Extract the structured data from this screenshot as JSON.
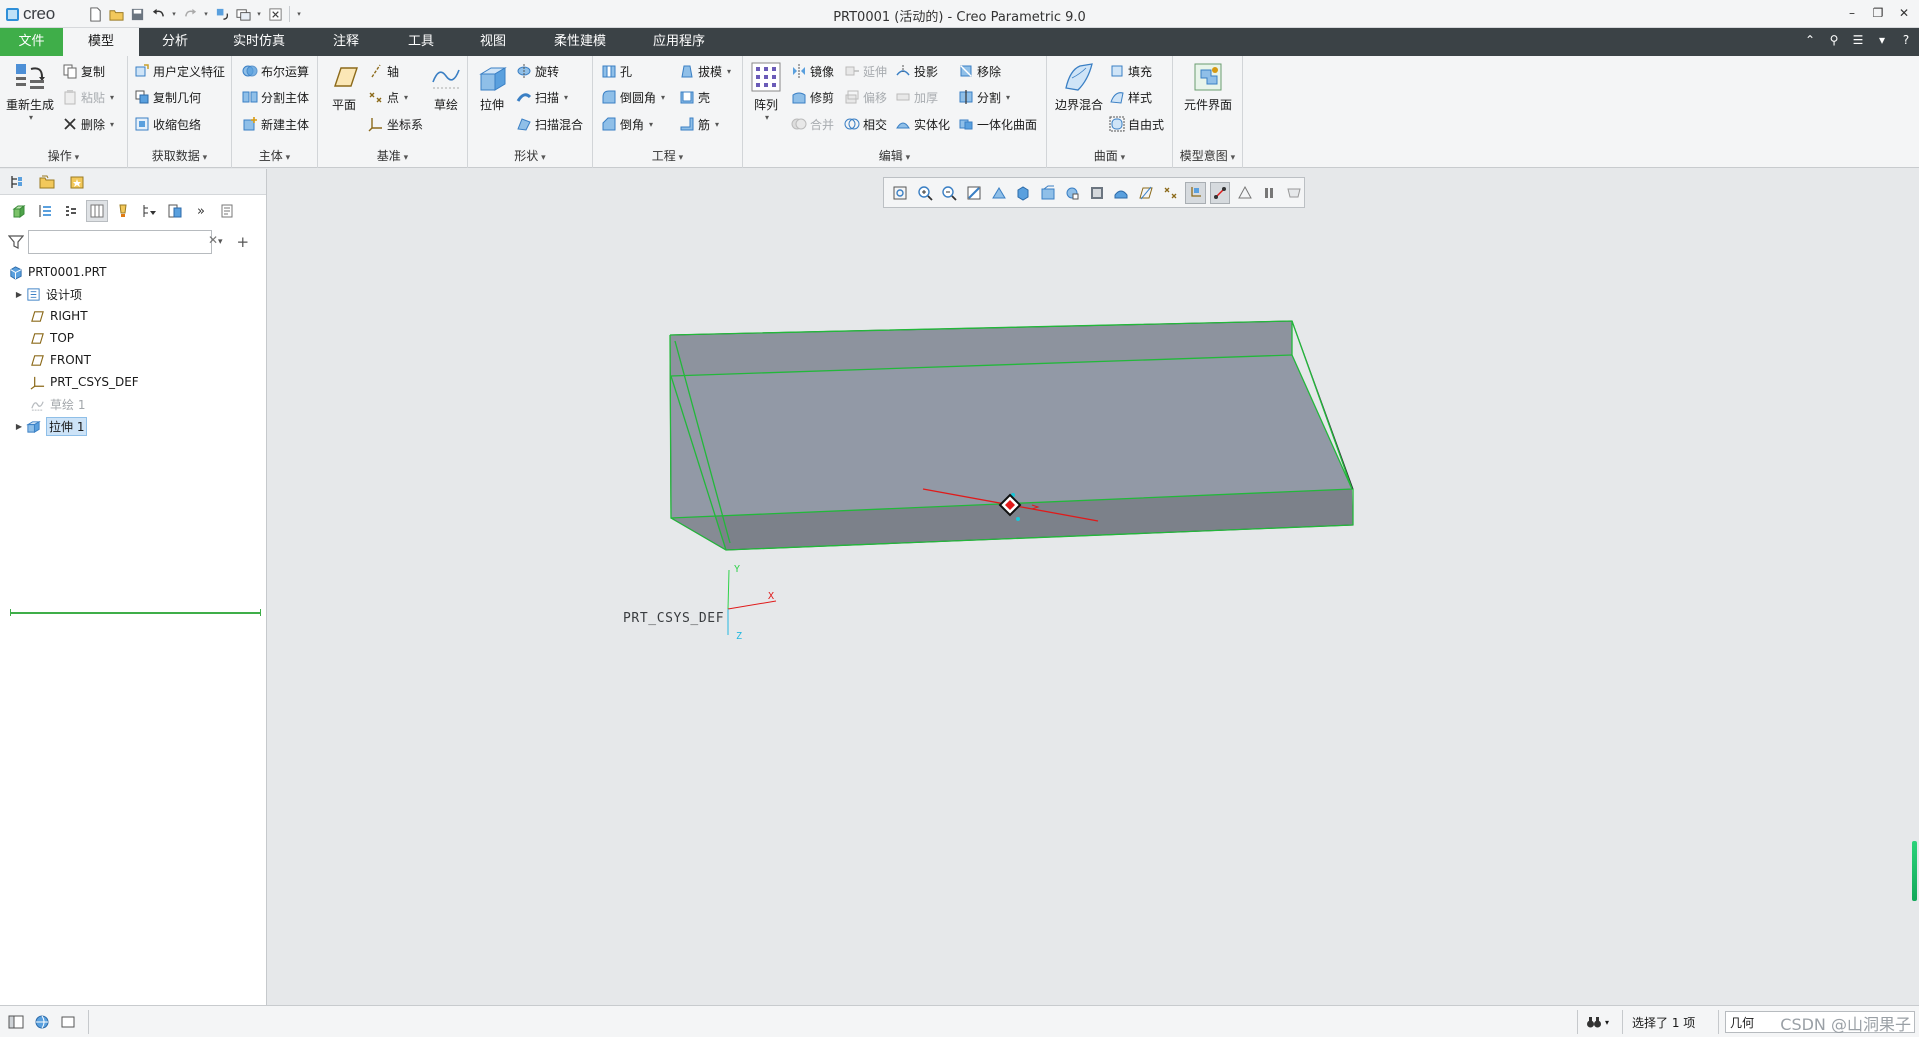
{
  "app": {
    "logo_text": "creo",
    "window_title": "PRT0001 (活动的) - Creo Parametric 9.0",
    "window_controls": [
      "–",
      "❐",
      "✕"
    ]
  },
  "tabs": [
    {
      "label": "文件",
      "kind": "file"
    },
    {
      "label": "模型",
      "kind": "active"
    },
    {
      "label": "分析",
      "kind": "normal"
    },
    {
      "label": "实时仿真",
      "kind": "normal"
    },
    {
      "label": "注释",
      "kind": "normal"
    },
    {
      "label": "工具",
      "kind": "normal"
    },
    {
      "label": "视图",
      "kind": "normal"
    },
    {
      "label": "柔性建模",
      "kind": "normal"
    },
    {
      "label": "应用程序",
      "kind": "normal"
    }
  ],
  "ribbon": {
    "operations": {
      "name": "操作",
      "regenerate": "重新生成",
      "copy": "复制",
      "paste": "粘贴",
      "delete": "删除"
    },
    "get_data": {
      "name": "获取数据",
      "udf": "用户定义特征",
      "copy_geom": "复制几何",
      "shrinkwrap": "收缩包络"
    },
    "body": {
      "name": "主体",
      "boolean": "布尔运算",
      "split_body": "分割主体",
      "new_body": "新建主体"
    },
    "datum": {
      "name": "基准",
      "plane": "平面",
      "axis": "轴",
      "point": "点",
      "csys": "坐标系",
      "sketch": "草绘"
    },
    "shapes": {
      "name": "形状",
      "extrude": "拉伸",
      "revolve": "旋转",
      "sweep": "扫描",
      "swept_blend": "扫描混合"
    },
    "engineering": {
      "name": "工程",
      "hole": "孔",
      "round": "倒圆角",
      "chamfer": "倒角",
      "draft": "拔模",
      "shell": "壳",
      "rib": "筋"
    },
    "editing": {
      "name": "编辑",
      "pattern": "阵列",
      "mirror": "镜像",
      "extend": "延伸",
      "project": "投影",
      "trim": "修剪",
      "offset": "偏移",
      "thicken": "加厚",
      "merge": "合并",
      "intersect": "相交",
      "solidify": "实体化",
      "remove": "移除",
      "split": "分割",
      "unify_surface": "一体化曲面"
    },
    "surfaces": {
      "name": "曲面",
      "boundary_blend": "边界混合",
      "fill": "填充",
      "style": "样式",
      "freestyle": "自由式"
    },
    "model_intent": {
      "name": "模型意图",
      "component_interface": "元件界面"
    }
  },
  "model_tree": {
    "filter_placeholder": "",
    "items": [
      {
        "label": "PRT0001.PRT",
        "icon": "part-icon",
        "expandable": false,
        "state": "normal"
      },
      {
        "label": "设计项",
        "icon": "design-items-icon",
        "expandable": true,
        "state": "normal"
      },
      {
        "label": "RIGHT",
        "icon": "datum-plane-icon",
        "expandable": false,
        "state": "normal"
      },
      {
        "label": "TOP",
        "icon": "datum-plane-icon",
        "expandable": false,
        "state": "normal"
      },
      {
        "label": "FRONT",
        "icon": "datum-plane-icon",
        "expandable": false,
        "state": "normal"
      },
      {
        "label": "PRT_CSYS_DEF",
        "icon": "csys-icon",
        "expandable": false,
        "state": "normal"
      },
      {
        "label": "草绘 1",
        "icon": "sketch-icon",
        "expandable": false,
        "state": "dim"
      },
      {
        "label": "拉伸 1",
        "icon": "extrude-icon",
        "expandable": true,
        "state": "selected"
      }
    ]
  },
  "viewport": {
    "csys_label": "PRT_CSYS_DEF",
    "axis_x": "X",
    "axis_y": "Y",
    "axis_z": "Z"
  },
  "status": {
    "selected": "选择了 1 项",
    "filter_value": "几何",
    "watermark": "CSDN @山洞果子"
  },
  "colors": {
    "file_tab": "#3fae49",
    "tab_bar": "#3b4246",
    "model_face": "#9299a6",
    "model_edge": "#22b83a",
    "selection": "#cde3f7"
  }
}
